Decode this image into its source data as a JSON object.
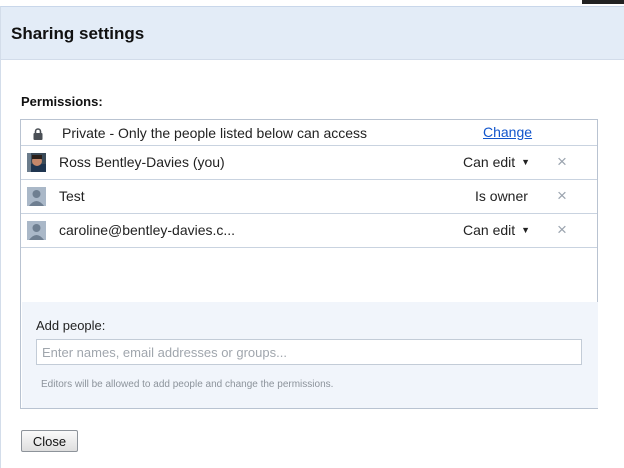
{
  "dialog": {
    "title": "Sharing settings",
    "permissions_label": "Permissions:"
  },
  "access": {
    "icon": "lock-icon",
    "text": "Private - Only the people listed below can access",
    "change_label": "Change"
  },
  "people": [
    {
      "name": "Ross Bentley-Davies (you)",
      "role": "Can edit",
      "has_dropdown": true,
      "avatar": "photo-avatar"
    },
    {
      "name": "Test",
      "role": "Is owner",
      "has_dropdown": false,
      "avatar": "default-avatar"
    },
    {
      "name": "caroline@bentley-davies.c...",
      "role": "Can edit",
      "has_dropdown": true,
      "avatar": "default-avatar"
    }
  ],
  "remove_glyph": "×",
  "dropdown_glyph": "▼",
  "add_people": {
    "label": "Add people:",
    "placeholder": "Enter names, email addresses or groups...",
    "value": "",
    "hint": "Editors will be allowed to add people and change the permissions."
  },
  "footer": {
    "close_label": "Close"
  },
  "colors": {
    "titlebar": "#e3ecf7",
    "link": "#1155cc",
    "add_panel": "#f1f5fb"
  }
}
